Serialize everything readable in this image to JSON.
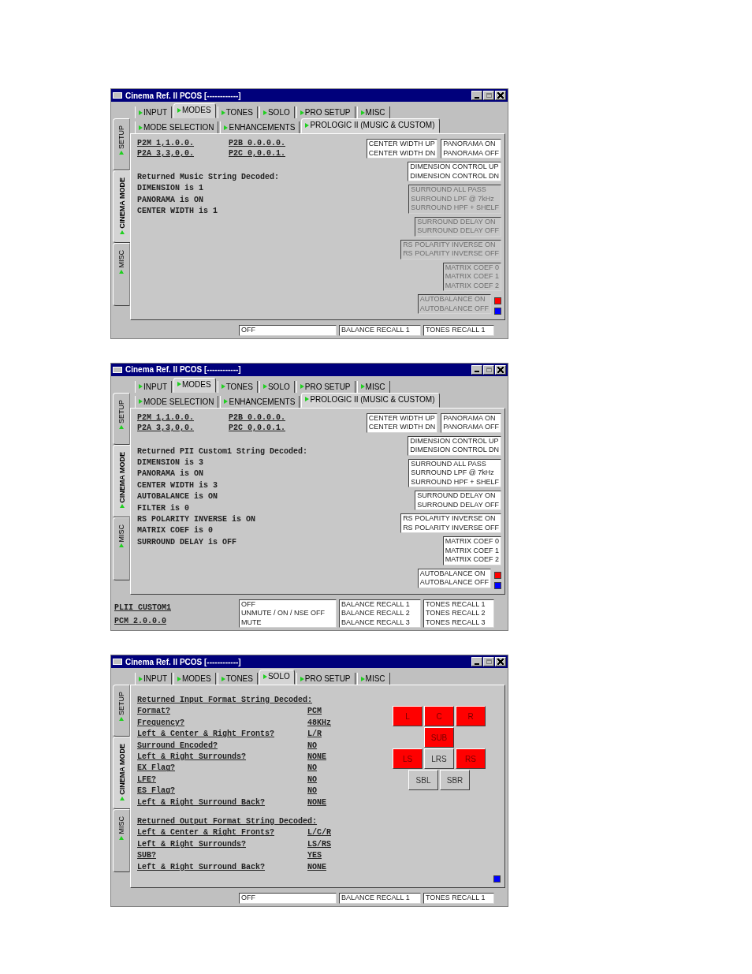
{
  "windows": [
    {
      "title": "Cinema Ref. II PCOS [------------]",
      "tabs": [
        {
          "label": "INPUT",
          "selected": false
        },
        {
          "label": "MODES",
          "selected": true
        },
        {
          "label": "TONES",
          "selected": false
        },
        {
          "label": "SOLO",
          "selected": false
        },
        {
          "label": "PRO SETUP",
          "selected": false
        },
        {
          "label": "MISC",
          "selected": false
        }
      ],
      "side_tabs": [
        {
          "label": "SETUP",
          "selected": false
        },
        {
          "label": "CINEMA MODE",
          "selected": true
        },
        {
          "label": "MISC",
          "selected": false
        }
      ],
      "subtabs": [
        {
          "label": "MODE SELECTION",
          "selected": false
        },
        {
          "label": "ENHANCEMENTS",
          "selected": false
        },
        {
          "label": "PROLOGIC II (MUSIC & CUSTOM)",
          "selected": true
        }
      ],
      "content": {
        "kind": "modes",
        "codes": [
          "P2M 1,1.0.0.",
          "P2B 0.0.0.0.",
          "P2A 3,3,0,0.",
          "P2C 0,0.0.1."
        ],
        "decoded": [
          "Returned Music String Decoded:",
          "DIMENSION is 1",
          "PANORAMA is ON",
          "CENTER WIDTH is 1"
        ],
        "option_rows": [
          [
            {
              "lines": [
                "CENTER WIDTH UP",
                "CENTER WIDTH DN"
              ],
              "disabled": false
            },
            {
              "lines": [
                "PANORAMA ON",
                "PANORAMA OFF"
              ],
              "disabled": false
            }
          ],
          [
            {
              "lines": [
                "DIMENSION CONTROL UP",
                "DIMENSION CONTROL DN"
              ],
              "disabled": false
            }
          ],
          [
            {
              "lines": [
                "SURROUND ALL PASS",
                "SURROUND LPF @ 7kHz",
                "SURROUND HPF + SHELF"
              ],
              "disabled": true
            }
          ],
          [
            {
              "lines": [
                "SURROUND DELAY ON",
                "SURROUND DELAY OFF"
              ],
              "disabled": true
            }
          ],
          [
            {
              "lines": [
                "RS POLARITY INVERSE ON",
                "RS POLARITY INVERSE OFF"
              ],
              "disabled": true
            }
          ],
          [
            {
              "lines": [
                "MATRIX COEF 0",
                "MATRIX COEF 1",
                "MATRIX COEF 2"
              ],
              "disabled": true
            }
          ],
          [
            {
              "lines": [
                "AUTOBALANCE ON",
                "AUTOBALANCE OFF"
              ],
              "disabled": true
            }
          ]
        ]
      },
      "bottom": {
        "lists": [
          [
            "OFF"
          ],
          [
            "BALANCE RECALL 1"
          ],
          [
            "TONES RECALL 1"
          ]
        ]
      }
    },
    {
      "title": "Cinema Ref. II PCOS [------------]",
      "tabs": [
        {
          "label": "INPUT",
          "selected": false
        },
        {
          "label": "MODES",
          "selected": true
        },
        {
          "label": "TONES",
          "selected": false
        },
        {
          "label": "SOLO",
          "selected": false
        },
        {
          "label": "PRO SETUP",
          "selected": false
        },
        {
          "label": "MISC",
          "selected": false
        }
      ],
      "side_tabs": [
        {
          "label": "SETUP",
          "selected": false
        },
        {
          "label": "CINEMA MODE",
          "selected": true
        },
        {
          "label": "MISC",
          "selected": false
        }
      ],
      "subtabs": [
        {
          "label": "MODE SELECTION",
          "selected": false
        },
        {
          "label": "ENHANCEMENTS",
          "selected": false
        },
        {
          "label": "PROLOGIC II (MUSIC & CUSTOM)",
          "selected": true
        }
      ],
      "content": {
        "kind": "modes",
        "codes": [
          "P2M 1,1.0.0.",
          "P2B 0.0.0.0.",
          "P2A 3,3,0,0.",
          "P2C 0,0.0.1."
        ],
        "decoded": [
          "Returned PII Custom1 String Decoded:",
          "DIMENSION is 3",
          "PANORAMA is ON",
          "CENTER WIDTH is 3",
          "AUTOBALANCE is ON",
          "FILTER is 0",
          "RS POLARITY INVERSE is ON",
          "MATRIX COEF is 0",
          "SURROUND DELAY is OFF"
        ],
        "option_rows": [
          [
            {
              "lines": [
                "CENTER WIDTH UP",
                "CENTER WIDTH DN"
              ],
              "disabled": false
            },
            {
              "lines": [
                "PANORAMA ON",
                "PANORAMA OFF"
              ],
              "disabled": false
            }
          ],
          [
            {
              "lines": [
                "DIMENSION CONTROL UP",
                "DIMENSION CONTROL DN"
              ],
              "disabled": false
            }
          ],
          [
            {
              "lines": [
                "SURROUND ALL PASS",
                "SURROUND LPF @ 7kHz",
                "SURROUND HPF + SHELF"
              ],
              "disabled": false
            }
          ],
          [
            {
              "lines": [
                "SURROUND DELAY ON",
                "SURROUND DELAY OFF"
              ],
              "disabled": false
            }
          ],
          [
            {
              "lines": [
                "RS POLARITY INVERSE ON",
                "RS POLARITY INVERSE OFF"
              ],
              "disabled": false
            }
          ],
          [
            {
              "lines": [
                "MATRIX COEF 0",
                "MATRIX COEF 1",
                "MATRIX COEF 2"
              ],
              "disabled": false
            }
          ],
          [
            {
              "lines": [
                "AUTOBALANCE ON",
                "AUTOBALANCE OFF"
              ],
              "disabled": false
            }
          ]
        ]
      },
      "bottom": {
        "texts": [
          "PLII CUSTOM1",
          "PCM 2.0.0.0"
        ],
        "lists": [
          [
            "OFF",
            "UNMUTE / ON / NSE OFF",
            "MUTE"
          ],
          [
            "BALANCE RECALL 1",
            "BALANCE RECALL 2",
            "BALANCE RECALL 3"
          ],
          [
            "TONES RECALL 1",
            "TONES RECALL 2",
            "TONES RECALL 3"
          ]
        ]
      }
    },
    {
      "title": "Cinema Ref. II PCOS [------------]",
      "tabs": [
        {
          "label": "INPUT",
          "selected": false
        },
        {
          "label": "MODES",
          "selected": false
        },
        {
          "label": "TONES",
          "selected": false
        },
        {
          "label": "SOLO",
          "selected": true
        },
        {
          "label": "PRO SETUP",
          "selected": false
        },
        {
          "label": "MISC",
          "selected": false
        }
      ],
      "side_tabs": [
        {
          "label": "SETUP",
          "selected": false
        },
        {
          "label": "CINEMA MODE",
          "selected": true
        },
        {
          "label": "MISC",
          "selected": false
        }
      ],
      "content": {
        "kind": "solo",
        "sections": [
          {
            "heading": "Returned Input Format String Decoded:",
            "rows": [
              {
                "label": "Format?",
                "value": "PCM"
              },
              {
                "label": "Frequency?",
                "value": "48KHz"
              },
              {
                "label": "Left & Center & Right Fronts?",
                "value": "L/R"
              },
              {
                "label": "Surround Encoded?",
                "value": "NO"
              },
              {
                "label": "Left & Right Surrounds?",
                "value": "NONE"
              },
              {
                "label": "EX Flag?",
                "value": "NO"
              },
              {
                "label": "LFE?",
                "value": "NO"
              },
              {
                "label": "ES Flag?",
                "value": "NO"
              },
              {
                "label": "Left & Right Surround Back?",
                "value": "NONE"
              }
            ]
          },
          {
            "heading": "Returned Output Format String Decoded:",
            "rows": [
              {
                "label": "Left & Center & Right Fronts?",
                "value": "L/C/R"
              },
              {
                "label": "Left & Right Surrounds?",
                "value": "LS/RS"
              },
              {
                "label": "SUB?",
                "value": "YES"
              },
              {
                "label": "Left & Right Surround Back?",
                "value": "NONE"
              }
            ]
          }
        ],
        "speaker_rows": [
          [
            {
              "label": "L",
              "on": true
            },
            {
              "label": "C",
              "on": true
            },
            {
              "label": "R",
              "on": true
            }
          ],
          [
            {
              "label": "SUB",
              "on": true
            }
          ],
          [
            {
              "label": "LS",
              "on": true
            },
            {
              "label": "LRS",
              "on": false
            },
            {
              "label": "RS",
              "on": true
            }
          ],
          [
            {
              "label": "SBL",
              "on": false
            },
            {
              "label": "SBR",
              "on": false
            }
          ]
        ]
      },
      "bottom": {
        "lists": [
          [
            "OFF"
          ],
          [
            "BALANCE RECALL 1"
          ],
          [
            "TONES RECALL 1"
          ]
        ]
      }
    }
  ]
}
